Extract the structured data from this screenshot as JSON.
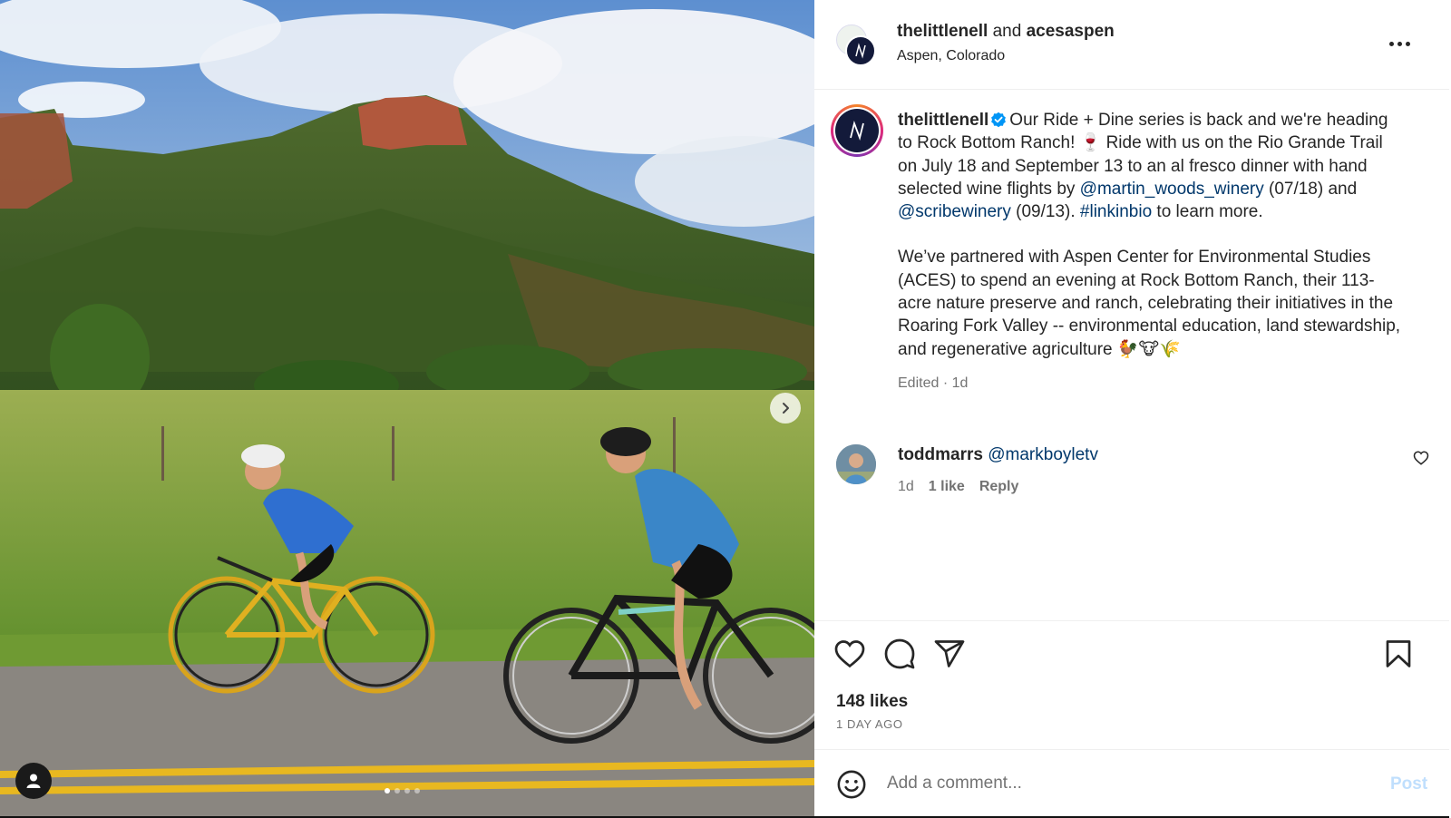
{
  "header": {
    "user1": "thelittlenell",
    "joiner": " and ",
    "user2": "acesaspen",
    "location": "Aspen, Colorado"
  },
  "caption": {
    "username": "thelittlenell",
    "text_1": "Our Ride + Dine series is back and we're heading to Rock Bottom Ranch! 🍷 Ride with us on the Rio Grande Trail on July 18 and September 13 to an al fresco dinner with hand selected wine flights by ",
    "mention_1": "@martin_woods_winery",
    "text_2": " (07/18) and ",
    "mention_2": "@scribewinery",
    "text_3": " (09/13). ",
    "hashtag": "#linkinbio",
    "text_4": " to learn more.",
    "paragraph_2": "We’ve partnered with Aspen Center for Environmental Studies (ACES) to spend an evening at Rock Bottom Ranch, their 113-acre nature preserve and ranch, celebrating their initiatives in the Roaring Fork Valley -- environmental education, land stewardship, and regenerative agriculture 🐓🐮🌾",
    "meta": "Edited · 1d"
  },
  "comment": {
    "username": "toddmarrs",
    "mention": "@markboyletv",
    "time": "1d",
    "likes": "1 like",
    "reply": "Reply"
  },
  "stats": {
    "likes": "148 likes",
    "posted": "1 DAY AGO"
  },
  "composer": {
    "placeholder": "Add a comment...",
    "post_label": "Post"
  },
  "carousel": {
    "slide_count": 4,
    "active_index": 0
  },
  "icons": {
    "next": "chevron-right-icon",
    "user_tag": "person-icon",
    "more": "more-horizontal-icon",
    "verified": "verified-badge-icon",
    "heart": "heart-icon",
    "comment": "comment-bubble-icon",
    "share": "paper-plane-icon",
    "save": "bookmark-icon",
    "emoji": "smiley-icon"
  },
  "colors": {
    "link": "#00376b",
    "verified": "#0095f6",
    "post_disabled": "#c0dffd",
    "secondary_text": "#737373"
  }
}
